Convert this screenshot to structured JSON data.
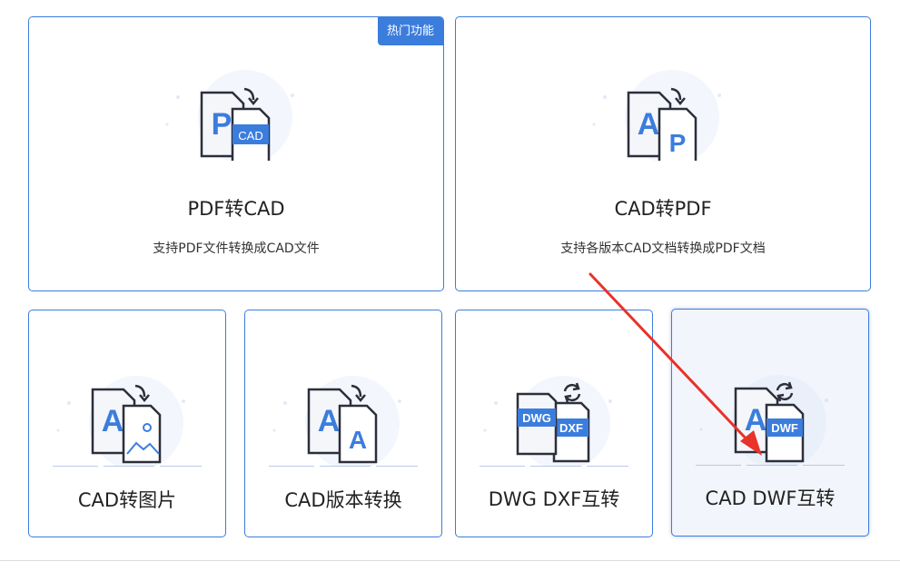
{
  "badge": {
    "hot": "热门功能"
  },
  "cards": [
    {
      "title": "PDF转CAD",
      "desc": "支持PDF文件转换成CAD文件",
      "icon": "pdf-to-cad-icon",
      "front": "CAD",
      "back": "P"
    },
    {
      "title": "CAD转PDF",
      "desc": "支持各版本CAD文档转换成PDF文档",
      "icon": "cad-to-pdf-icon",
      "front": "P",
      "back": "A"
    },
    {
      "title": "CAD转图片",
      "icon": "cad-to-image-icon",
      "back": "A"
    },
    {
      "title": "CAD版本转换",
      "icon": "cad-version-convert-icon",
      "front": "A",
      "back": "A"
    },
    {
      "title": "DWG DXF互转",
      "icon": "dwg-dxf-convert-icon",
      "front": "DXF",
      "back": "DWG"
    },
    {
      "title": "CAD DWF互转",
      "icon": "cad-dwf-convert-icon",
      "front": "DWF",
      "back": "A"
    }
  ],
  "colors": {
    "accent": "#3b7ddd",
    "annotation_arrow": "#e8322a"
  }
}
